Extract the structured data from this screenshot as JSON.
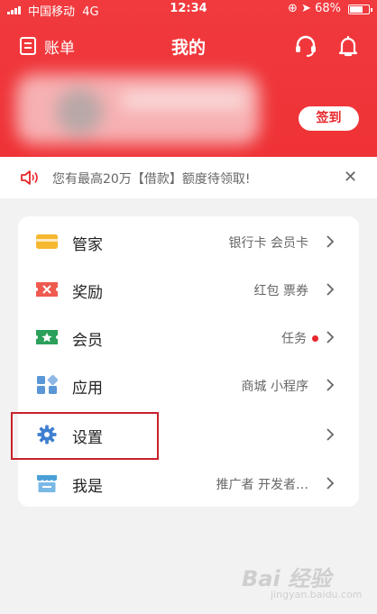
{
  "status_bar": {
    "carrier": "中国移动",
    "network": "4G",
    "time": "12:34",
    "battery": "68%"
  },
  "header": {
    "bill_label": "账单",
    "title": "我的",
    "sign_in_label": "签到"
  },
  "notice": {
    "text": "您有最高20万【借款】额度待领取!",
    "close": "✕"
  },
  "menu": [
    {
      "label": "管家",
      "sub": "银行卡 会员卡",
      "icon": "card-icon",
      "color": "#f5b82e"
    },
    {
      "label": "奖励",
      "sub": "红包 票券",
      "icon": "coupon-icon",
      "color": "#ef5a4f"
    },
    {
      "label": "会员",
      "sub": "任务",
      "icon": "ticket-star-icon",
      "color": "#2aa05a",
      "badge": true
    },
    {
      "label": "应用",
      "sub": "商城 小程序",
      "icon": "apps-grid-icon",
      "color": "#5b97d6"
    },
    {
      "label": "设置",
      "sub": "",
      "icon": "gear-icon",
      "color": "#3f7fd0"
    },
    {
      "label": "我是",
      "sub": "推广者 开发者…",
      "icon": "store-icon",
      "color": "#4a9fd8"
    }
  ],
  "watermark": {
    "brand": "Bai 经验",
    "url": "jingyan.baidu.com"
  }
}
